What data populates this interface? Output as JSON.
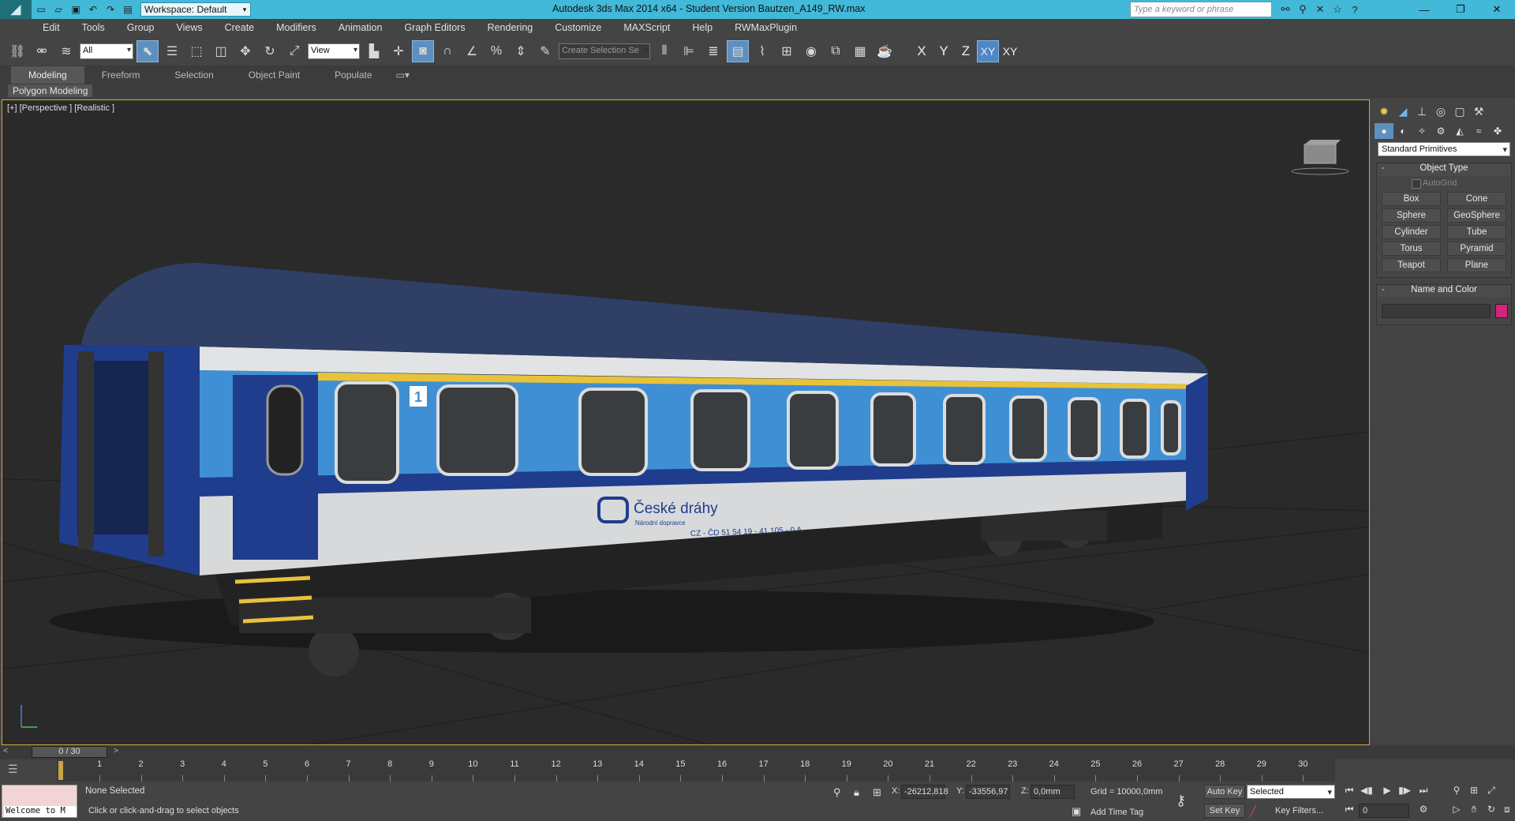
{
  "titlebar": {
    "workspace": "Workspace: Default",
    "app_title": "Autodesk 3ds Max  2014 x64  - Student Version    Bautzen_A149_RW.max",
    "search_placeholder": "Type a keyword or phrase"
  },
  "menu": [
    "Edit",
    "Tools",
    "Group",
    "Views",
    "Create",
    "Modifiers",
    "Animation",
    "Graph Editors",
    "Rendering",
    "Customize",
    "MAXScript",
    "Help",
    "RWMaxPlugin"
  ],
  "toolbar": {
    "filter_select": "All",
    "ref_coord_select": "View",
    "named_selection_placeholder": "Create Selection Se",
    "axes": [
      "X",
      "Y",
      "Z",
      "XY",
      "XY"
    ]
  },
  "ribbon": {
    "tabs": [
      "Modeling",
      "Freeform",
      "Selection",
      "Object Paint",
      "Populate"
    ],
    "active_tab": "Modeling",
    "panel_label": "Polygon Modeling"
  },
  "viewport": {
    "label": "[+] [Perspective ] [Realistic ]",
    "train_brand": "České dráhy",
    "train_sub": "Národní dopravce",
    "train_number": "CZ - ČD  51 54 19 - 41 105 - 0  A",
    "class_number": "1"
  },
  "command_panel": {
    "category_select": "Standard Primitives",
    "object_type_header": "Object Type",
    "autogrid_label": "AutoGrid",
    "buttons": [
      "Box",
      "Cone",
      "Sphere",
      "GeoSphere",
      "Cylinder",
      "Tube",
      "Torus",
      "Pyramid",
      "Teapot",
      "Plane"
    ],
    "name_color_header": "Name and Color",
    "object_color": "#d4237a"
  },
  "timeline": {
    "frame_display": "0 / 30",
    "ticks": [
      "1",
      "2",
      "3",
      "4",
      "5",
      "6",
      "7",
      "8",
      "9",
      "10",
      "11",
      "12",
      "13",
      "14",
      "15",
      "16",
      "17",
      "18",
      "19",
      "20",
      "21",
      "22",
      "23",
      "24",
      "25",
      "26",
      "27",
      "28",
      "29",
      "30"
    ]
  },
  "status": {
    "welcome": "Welcome to M",
    "selection": "None Selected",
    "prompt": "Click or click-and-drag to select objects",
    "x_label": "X:",
    "x_value": "-26212,818",
    "y_label": "Y:",
    "y_value": "-33556,97",
    "z_label": "Z:",
    "z_value": "0,0mm",
    "grid": "Grid = 10000,0mm",
    "add_time_tag": "Add Time Tag",
    "auto_key": "Auto Key",
    "set_key": "Set Key",
    "selected_select": "Selected",
    "key_filters": "Key Filters...",
    "frame_value": "0"
  },
  "colors": {
    "titlebar": "#42b9d8",
    "viewport_border": "#d3a73c",
    "train_blue": "#3f8fd4",
    "train_dark_blue": "#1f3d8c",
    "train_roof": "#2f3f66",
    "train_yellow": "#e8c23a"
  }
}
